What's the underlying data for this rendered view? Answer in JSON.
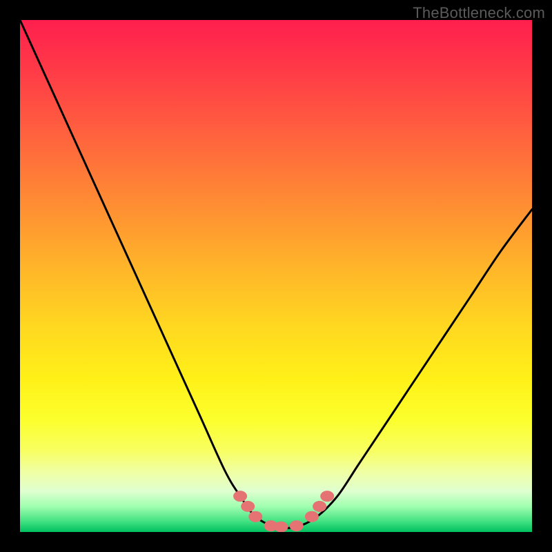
{
  "watermark": "TheBottleneck.com",
  "chart_data": {
    "type": "line",
    "title": "",
    "xlabel": "",
    "ylabel": "",
    "xlim": [
      0,
      1
    ],
    "ylim": [
      0,
      1
    ],
    "series": [
      {
        "name": "bottleneck-curve",
        "x": [
          0.0,
          0.05,
          0.1,
          0.15,
          0.2,
          0.25,
          0.3,
          0.35,
          0.4,
          0.43,
          0.46,
          0.5,
          0.54,
          0.58,
          0.62,
          0.66,
          0.7,
          0.76,
          0.82,
          0.88,
          0.94,
          1.0
        ],
        "y": [
          1.0,
          0.89,
          0.78,
          0.67,
          0.56,
          0.45,
          0.34,
          0.23,
          0.12,
          0.07,
          0.03,
          0.01,
          0.01,
          0.03,
          0.07,
          0.13,
          0.19,
          0.28,
          0.37,
          0.46,
          0.55,
          0.63
        ]
      }
    ],
    "markers": {
      "name": "highlight-dots",
      "color": "#e57373",
      "x": [
        0.43,
        0.445,
        0.46,
        0.49,
        0.51,
        0.54,
        0.57,
        0.585,
        0.6
      ],
      "y": [
        0.07,
        0.05,
        0.03,
        0.012,
        0.01,
        0.012,
        0.03,
        0.05,
        0.07
      ]
    }
  }
}
